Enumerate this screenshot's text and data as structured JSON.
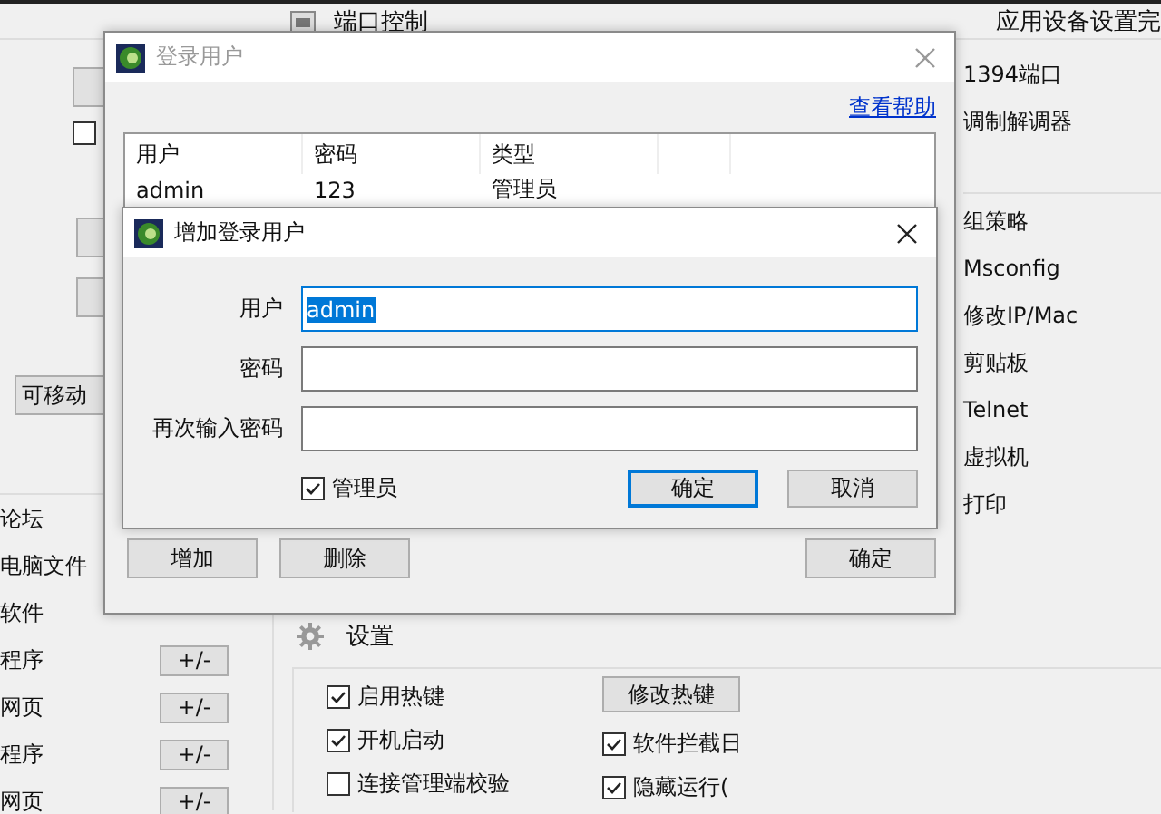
{
  "background_app": {
    "header_title": "端口控制",
    "header_status": "应用设备设置完",
    "left_checkbox": {
      "checked": false
    },
    "movable_button": "可移动",
    "left_items": [
      {
        "label": "论坛"
      },
      {
        "label": "电脑文件"
      },
      {
        "label": "软件"
      },
      {
        "label": "程序",
        "button": "+/-"
      },
      {
        "label": "网页",
        "button": "+/-"
      },
      {
        "label": "程序",
        "button": "+/-"
      },
      {
        "label": "网页",
        "button": "+/-"
      }
    ],
    "right_groups": [
      [
        "1394端口",
        "调制解调器"
      ],
      [
        "组策略",
        "Msconfig",
        "修改IP/Mac",
        "剪贴板",
        "Telnet",
        "虚拟机",
        "打印"
      ]
    ],
    "settings": {
      "title": "设置",
      "hotkey_button": "修改热键",
      "options_left": [
        {
          "label": "启用热键",
          "checked": true
        },
        {
          "label": "开机启动",
          "checked": true
        },
        {
          "label": "连接管理端校验",
          "checked": false
        }
      ],
      "options_right": [
        {
          "label": "软件拦截日",
          "checked": true
        },
        {
          "label": "隐藏运行(",
          "checked": true
        }
      ]
    }
  },
  "login_dialog": {
    "title": "登录用户",
    "help_link": "查看帮助",
    "table": {
      "columns": [
        "用户",
        "密码",
        "类型"
      ],
      "rows": [
        [
          "admin",
          "123",
          "管理员"
        ]
      ]
    },
    "buttons": [
      "增加",
      "删除",
      "确定"
    ]
  },
  "add_dialog": {
    "title": "增加登录用户",
    "fields": [
      {
        "label": "用户",
        "value": "admin",
        "value_selected": true,
        "focused": true
      },
      {
        "label": "密码",
        "focused": false
      },
      {
        "label": "再次输入密码",
        "focused": false
      }
    ],
    "admin_checkbox": {
      "label": "管理员",
      "checked": true
    },
    "buttons": [
      {
        "label": "确定",
        "default": true
      },
      {
        "label": "取消",
        "default": false
      }
    ]
  }
}
